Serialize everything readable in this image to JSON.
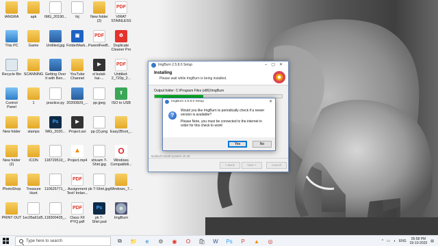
{
  "desktop_icons": [
    {
      "label": "IANGRA",
      "glyph": "folder"
    },
    {
      "label": "apk",
      "glyph": "folder"
    },
    {
      "label": "IMG_20190...",
      "glyph": "doc"
    },
    {
      "label": "hij",
      "glyph": "doc"
    },
    {
      "label": "New folder (2)",
      "glyph": "folder"
    },
    {
      "label": "VIRAT STAINLESS I...",
      "glyph": "pdf"
    },
    {
      "label": "This PC",
      "glyph": "pc"
    },
    {
      "label": "Game",
      "glyph": "folder"
    },
    {
      "label": "Untitled.jpg",
      "glyph": "img"
    },
    {
      "label": "FolderMark...",
      "glyph": "blue"
    },
    {
      "label": "ParentFeeB...",
      "glyph": "pdf"
    },
    {
      "label": "Duplicate Cleaner Pro",
      "glyph": "red"
    },
    {
      "label": "Recycle Bin",
      "glyph": "bin"
    },
    {
      "label": "SCANNING",
      "glyph": "folder"
    },
    {
      "label": "Getting Over It with Ben...",
      "glyph": "img"
    },
    {
      "label": "YouTube Channel Log...",
      "glyph": "folder"
    },
    {
      "label": "xl bulati-hai-...",
      "glyph": "dark"
    },
    {
      "label": "Untitled-2_720p_2...",
      "glyph": "pdf"
    },
    {
      "label": "Control Panel",
      "glyph": "pc"
    },
    {
      "label": "1",
      "glyph": "folder"
    },
    {
      "label": "practice.py",
      "glyph": "doc"
    },
    {
      "label": "20200829_...",
      "glyph": "img"
    },
    {
      "label": "pp.jpeg",
      "glyph": "doc"
    },
    {
      "label": "ISO to USB",
      "glyph": "green"
    },
    {
      "label": "New folder",
      "glyph": "folder"
    },
    {
      "label": "stamps",
      "glyph": "folder"
    },
    {
      "label": "IMG_2020...",
      "glyph": "ps"
    },
    {
      "label": "Project.avi",
      "glyph": "dark"
    },
    {
      "label": "pp (2).png",
      "glyph": "doc"
    },
    {
      "label": "Easy2Boot_...",
      "glyph": "folder"
    },
    {
      "label": "New folder (2)",
      "glyph": "folder"
    },
    {
      "label": "ICON",
      "glyph": "folder"
    },
    {
      "label": "118729510_...",
      "glyph": "doc"
    },
    {
      "label": "Project.mp4",
      "glyph": "cone"
    },
    {
      "label": "shivam T-Shirt.jpg",
      "glyph": "doc"
    },
    {
      "label": "Windows Compatibili...",
      "glyph": "opera"
    },
    {
      "label": "PhotoShop",
      "glyph": "folder"
    },
    {
      "label": "Treasure Hunt",
      "glyph": "folder"
    },
    {
      "label": "110625771_...",
      "glyph": "doc"
    },
    {
      "label": "Assignment Text! Inrlan...",
      "glyph": "pdf"
    },
    {
      "label": "pk T-Shirt.jpg",
      "glyph": "doc"
    },
    {
      "label": "Windows_7...",
      "glyph": "folder"
    },
    {
      "label": "PRINT OUT",
      "glyph": "folder"
    },
    {
      "label": "1ec05a61d5...",
      "glyph": "doc"
    },
    {
      "label": "118300435_...",
      "glyph": "doc"
    },
    {
      "label": "Class XII PYQ.pdf",
      "glyph": "pdf"
    },
    {
      "label": "pk T-Shirt.psd",
      "glyph": "ps"
    },
    {
      "label": "ImgBurn",
      "glyph": "disc"
    }
  ],
  "setup_window": {
    "title": "ImgBurn 2.5.8.0 Setup",
    "header_title": "Installing",
    "header_subtitle": "Please wait while ImgBurn is being installed.",
    "output_folder": "Output folder: C:\\Program Files (x86)\\ImgBurn",
    "progress_fraction": 0.38,
    "brand": "Nullsoft Install System v2.46",
    "back_label": "< Back",
    "next_label": "Next >",
    "cancel_label": "Cancel"
  },
  "message_box": {
    "title": "ImgBurn 2.5.8.0 Setup",
    "icon": "question-icon",
    "line1": "Would you like ImgBurn to periodically check if a newer version is available?",
    "line2": "Please Note, you must be connected to the internet in order for this check to work!",
    "yes_label": "Yes",
    "no_label": "No"
  },
  "taskbar": {
    "search_placeholder": "Type here to search",
    "apps": [
      "task-view",
      "file-explorer",
      "edge",
      "settings",
      "chrome",
      "opera",
      "store",
      "word",
      "photoshop",
      "powerpoint",
      "vlc",
      "imgburn"
    ],
    "language": "ENG",
    "time": "05:58 PM",
    "date": "03-10-2020"
  },
  "colors": {
    "accent": "#0078d7",
    "progress": "#06b025"
  }
}
